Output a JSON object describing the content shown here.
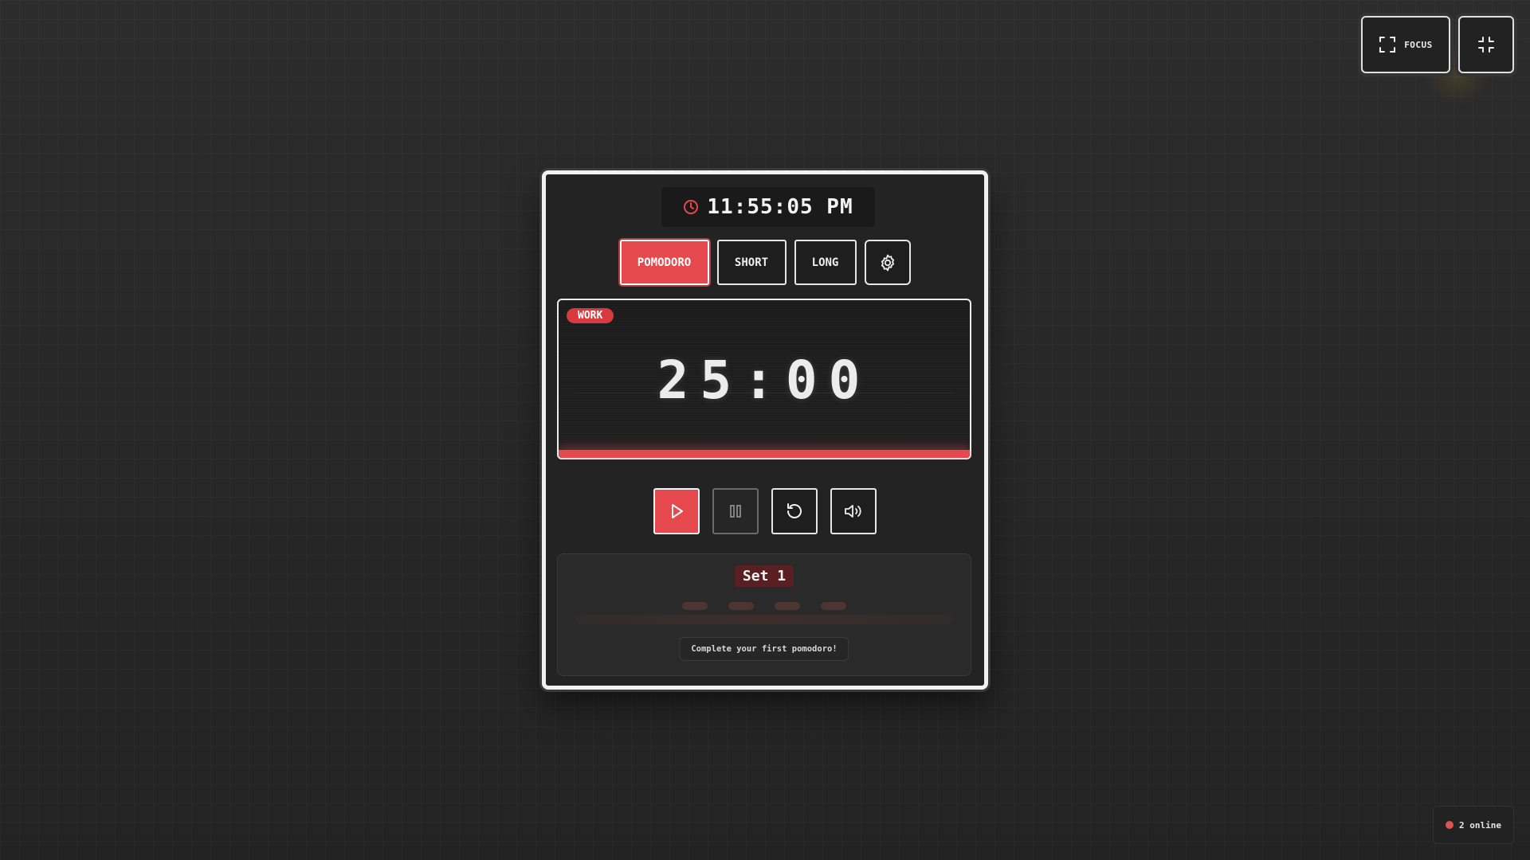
{
  "colors": {
    "accent": "#e5484d",
    "background": "#262626",
    "online_indicator": "#d9534f"
  },
  "top_bar": {
    "focus_label": "FOCUS",
    "focus_icon": "fullscreen-icon",
    "compact_icon": "minimize-icon"
  },
  "clock": {
    "icon": "clock-icon",
    "time": "11:55:05 PM"
  },
  "modes": {
    "items": [
      {
        "label": "POMODORO",
        "active": true
      },
      {
        "label": "SHORT",
        "active": false
      },
      {
        "label": "LONG",
        "active": false
      }
    ],
    "settings_icon": "gear-icon"
  },
  "timer": {
    "badge": "WORK",
    "display": "25:00",
    "progress": 1.0
  },
  "controls": {
    "play_icon": "play-icon",
    "pause_icon": "pause-icon",
    "reset_icon": "reset-icon",
    "sound_icon": "volume-icon"
  },
  "sets": {
    "label": "Set 1",
    "completed": 0,
    "total": 4,
    "message": "Complete your first pomodoro!"
  },
  "status": {
    "online_text": "2 online"
  }
}
